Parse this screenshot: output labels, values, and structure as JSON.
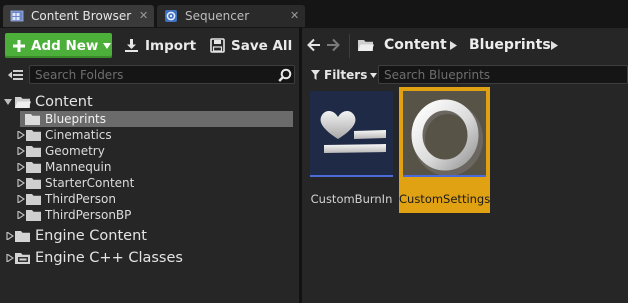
{
  "tabs": [
    {
      "label": "Content Browser",
      "icon": "content-browser-icon",
      "close": "✕"
    },
    {
      "label": "Sequencer",
      "icon": "sequencer-icon",
      "close": "✕"
    }
  ],
  "toolbar": {
    "add_new_label": "Add New",
    "import_label": "Import",
    "save_all_label": "Save All"
  },
  "sources": {
    "search_placeholder": "Search Folders",
    "tree": [
      {
        "label": "Content",
        "level": 0,
        "expanded": true,
        "type": "folder"
      },
      {
        "label": "Blueprints",
        "level": 1,
        "selected": true,
        "type": "folder"
      },
      {
        "label": "Cinematics",
        "level": 1,
        "type": "folder"
      },
      {
        "label": "Geometry",
        "level": 1,
        "type": "folder"
      },
      {
        "label": "Mannequin",
        "level": 1,
        "type": "folder"
      },
      {
        "label": "StarterContent",
        "level": 1,
        "type": "folder"
      },
      {
        "label": "ThirdPerson",
        "level": 1,
        "type": "folder"
      },
      {
        "label": "ThirdPersonBP",
        "level": 1,
        "type": "folder"
      },
      {
        "label": "Engine Content",
        "level": 0,
        "type": "folder"
      },
      {
        "label": "Engine C++ Classes",
        "level": 0,
        "type": "cpp-folder"
      }
    ]
  },
  "path": {
    "crumbs": [
      "Content",
      "Blueprints"
    ]
  },
  "assets": {
    "filters_label": "Filters",
    "search_placeholder": "Search Blueprints",
    "items": [
      {
        "label": "CustomBurnIn",
        "selected": false,
        "icon": "burn-in-icon"
      },
      {
        "label": "CustomSettings",
        "selected": true,
        "icon": "ring-icon"
      }
    ]
  },
  "colors": {
    "accent_green": "#4caf3a",
    "selection_orange": "#e0a213",
    "asset_strip_blue": "#4c6ad8",
    "panel_bg": "#262626"
  }
}
